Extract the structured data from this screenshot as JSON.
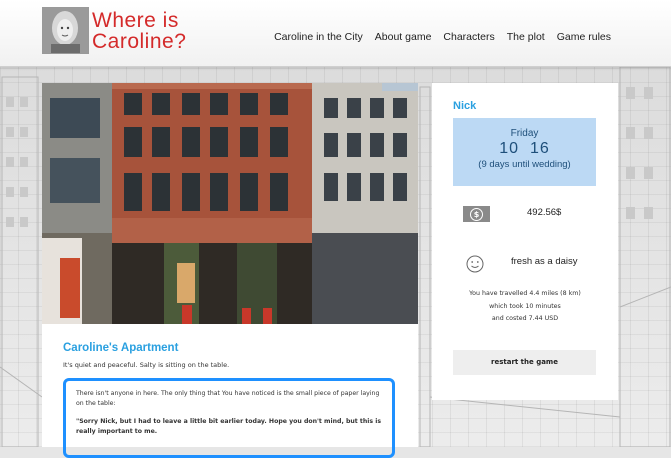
{
  "header": {
    "logo_line1": "Where is",
    "logo_line2": "Caroline?",
    "nav": [
      "Caroline in the City",
      "About game",
      "Characters",
      "The plot",
      "Game rules"
    ]
  },
  "location": {
    "title": "Caroline's Apartment",
    "description": "It's quiet and peaceful. Salty is sitting on the table.",
    "text_paragraph": "There isn't anyone in here. The only thing that You have noticed is the small piece of paper laying on the table:",
    "note_text": "\"Sorry Nick, but I had to leave a little bit earlier today. Hope you don't mind, but this is really important to me."
  },
  "status": {
    "player_name": "Nick",
    "day": "Friday",
    "time_hour": "10",
    "time_min": "16",
    "until_wedding": "(9 days until wedding)",
    "money": "492.56$",
    "money_icon_glyph": "$",
    "mood": "fresh as a daisy",
    "travel_line1": "You have travelled 4.4 miles (8 km)",
    "travel_line2": "which took 10 minutes",
    "travel_line3": "and costed 7.44 USD",
    "restart_label": "restart the game"
  },
  "colors": {
    "accent_blue": "#2aa0e0",
    "logo_red": "#d42a2a",
    "date_box": "#bcd9f4",
    "textbox_border": "#1e90ff"
  }
}
